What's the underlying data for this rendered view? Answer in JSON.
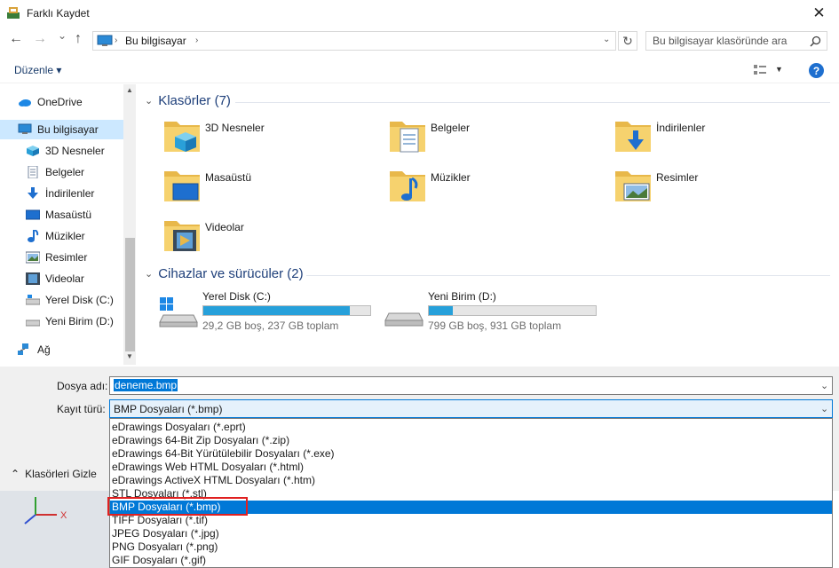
{
  "window": {
    "title": "Farklı Kaydet",
    "close_glyph": "✕"
  },
  "nav": {
    "back_glyph": "←",
    "forward_glyph": "→",
    "recent_glyph": "⌄",
    "up_glyph": "↑",
    "breadcrumb": "Bu bilgisayar",
    "breadcrumb_sep": "›",
    "refresh_glyph": "↻",
    "search_placeholder": "Bu bilgisayar klasöründe ara"
  },
  "toolbar": {
    "organize_label": "Düzenle ▾",
    "help_glyph": "?"
  },
  "sidebar": {
    "items": [
      {
        "label": "OneDrive",
        "icon": "cloud-icon"
      },
      {
        "label": "Bu bilgisayar",
        "icon": "computer-icon"
      },
      {
        "label": "3D Nesneler",
        "icon": "cube-icon"
      },
      {
        "label": "Belgeler",
        "icon": "document-icon"
      },
      {
        "label": "İndirilenler",
        "icon": "download-icon"
      },
      {
        "label": "Masaüstü",
        "icon": "desktop-icon"
      },
      {
        "label": "Müzikler",
        "icon": "music-icon"
      },
      {
        "label": "Resimler",
        "icon": "picture-icon"
      },
      {
        "label": "Videolar",
        "icon": "video-icon"
      },
      {
        "label": "Yerel Disk (C:)",
        "icon": "drive-icon"
      },
      {
        "label": "Yeni Birim (D:)",
        "icon": "drive-icon"
      },
      {
        "label": "Ağ",
        "icon": "network-icon"
      }
    ]
  },
  "main": {
    "folders_header": "Klasörler (7)",
    "folders": [
      {
        "label": "3D Nesneler",
        "icon": "cube-icon"
      },
      {
        "label": "Belgeler",
        "icon": "document-icon"
      },
      {
        "label": "İndirilenler",
        "icon": "download-icon"
      },
      {
        "label": "Masaüstü",
        "icon": "desktop-icon"
      },
      {
        "label": "Müzikler",
        "icon": "music-icon"
      },
      {
        "label": "Resimler",
        "icon": "picture-icon"
      },
      {
        "label": "Videolar",
        "icon": "video-icon"
      }
    ],
    "devices_header": "Cihazlar ve sürücüler (2)",
    "drives": [
      {
        "label": "Yerel Disk (C:)",
        "space": "29,2 GB boş, 237 GB toplam",
        "used_fraction": 0.877
      },
      {
        "label": "Yeni Birim (D:)",
        "space": "799 GB boş, 931 GB toplam",
        "used_fraction": 0.142
      }
    ]
  },
  "form": {
    "filename_label": "Dosya adı:",
    "filename_value": "deneme.bmp",
    "type_label": "Kayıt türü:",
    "type_value": "BMP Dosyaları (*.bmp)",
    "type_options": [
      "eDrawings Dosyaları (*.eprt)",
      "eDrawings 64-Bit Zip Dosyaları (*.zip)",
      "eDrawings 64-Bit Yürütülebilir Dosyaları (*.exe)",
      "eDrawings Web HTML Dosyaları (*.html)",
      "eDrawings ActiveX HTML Dosyaları (*.htm)",
      "STL Dosyaları (*.stl)",
      "BMP Dosyaları (*.bmp)",
      "TIFF Dosyaları (*.tif)",
      "JPEG Dosyaları (*.jpg)",
      "PNG Dosyaları (*.png)",
      "GIF Dosyaları (*.gif)"
    ],
    "selected_index": 6,
    "hide_folders_label": "Klasörleri Gizle",
    "hide_folders_glyph": "⌃"
  },
  "background": {
    "axis_label": "X"
  },
  "colors": {
    "accent": "#0078d7",
    "highlight_box": "#e02020"
  }
}
